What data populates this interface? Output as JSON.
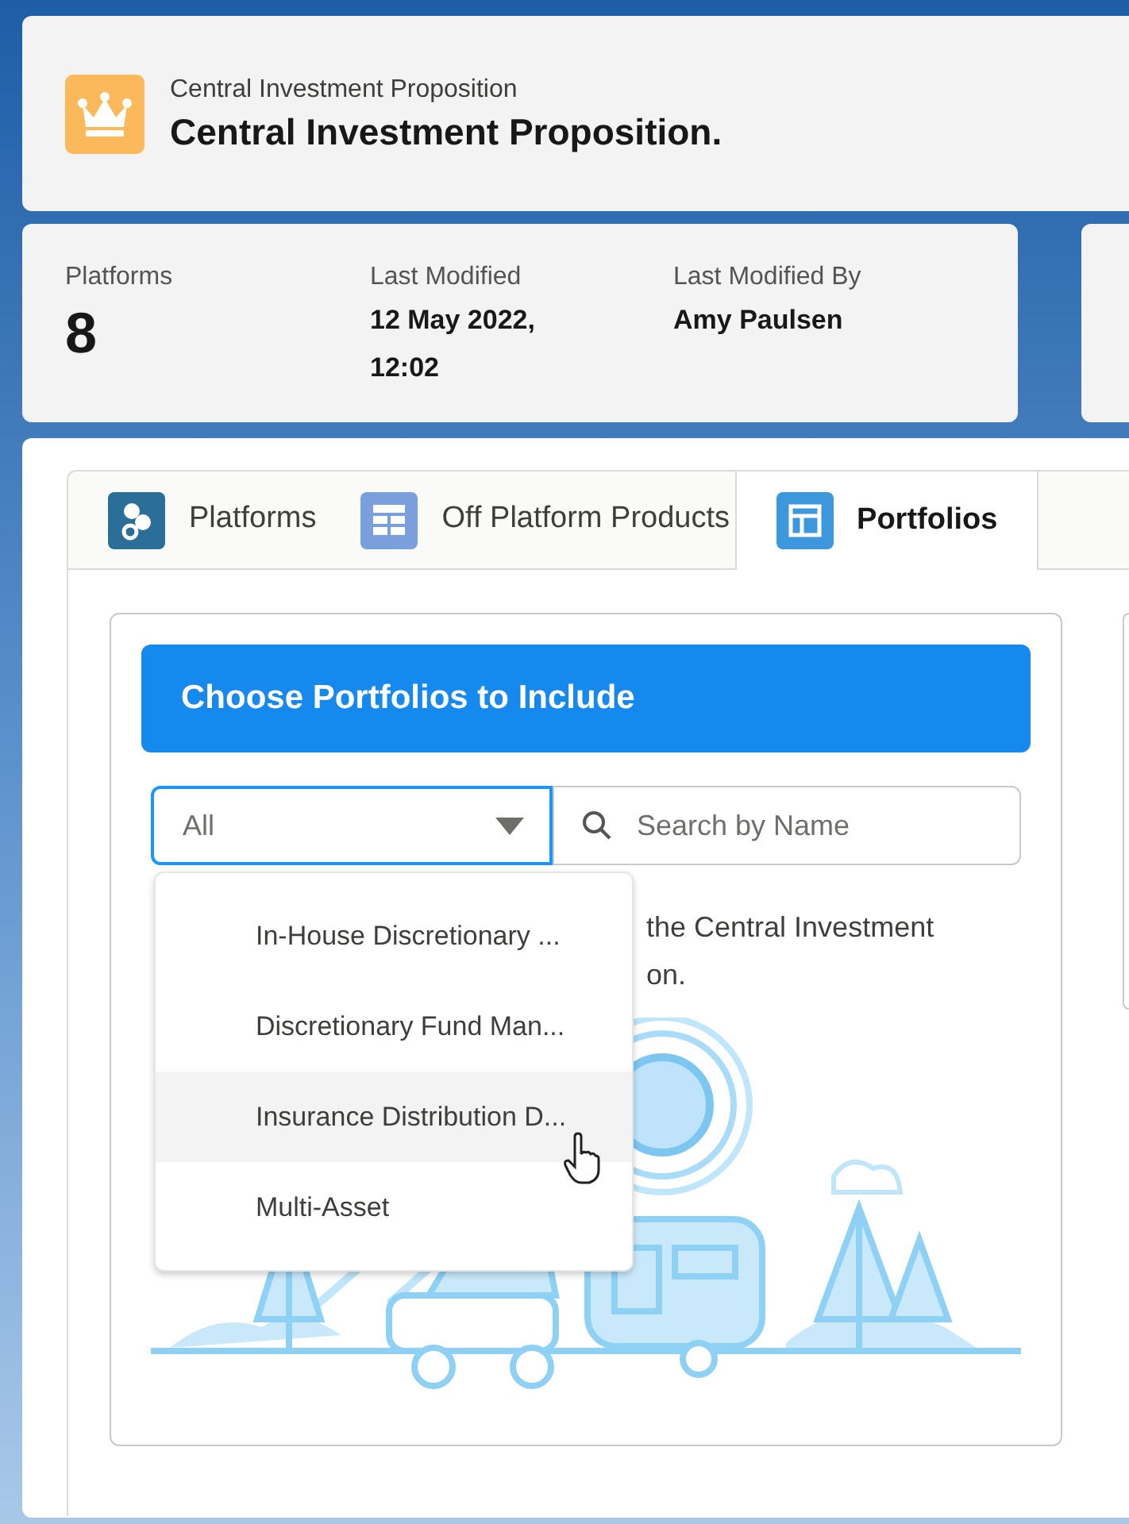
{
  "header": {
    "subtitle": "Central Investment Proposition",
    "title": "Central Investment Proposition."
  },
  "highlights": [
    {
      "label": "Platforms",
      "value": "8",
      "kind": "big"
    },
    {
      "label": "Last Modified",
      "value": "12 May 2022, 12:02",
      "kind": "small"
    },
    {
      "label": "Last Modified By",
      "value": "Amy Paulsen",
      "kind": "small"
    }
  ],
  "tabs": [
    {
      "label": "Platforms",
      "selected": false
    },
    {
      "label": "Off Platform Products",
      "selected": false
    },
    {
      "label": "Portfolios",
      "selected": true
    }
  ],
  "panel": {
    "title": "Choose Portfolios to Include",
    "filter": {
      "value": "All",
      "expanded": true
    },
    "search": {
      "placeholder": "Search by Name"
    },
    "description_lines": [
      "the Central Investment",
      "on."
    ],
    "menu": [
      {
        "label": "In-House Discretionary ...",
        "selected": false
      },
      {
        "label": "Discretionary Fund Man...",
        "selected": false
      },
      {
        "label": "Insurance Distribution D...",
        "selected": true
      },
      {
        "label": "Multi-Asset",
        "selected": false
      }
    ]
  }
}
